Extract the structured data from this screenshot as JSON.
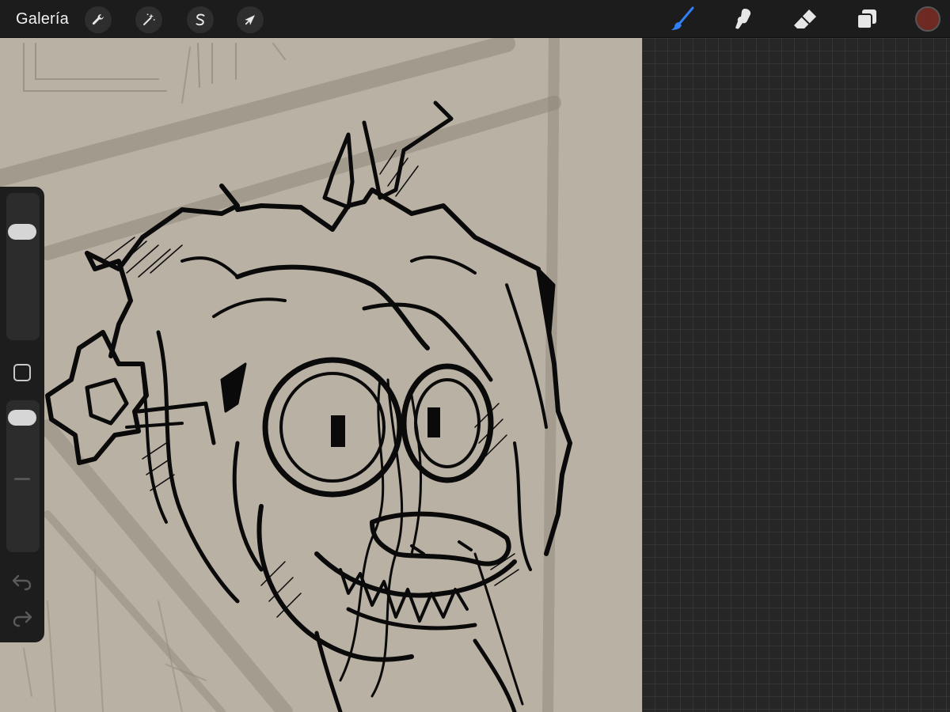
{
  "toolbar": {
    "gallery_label": "Galería",
    "left_tools": [
      {
        "icon": "wrench-icon",
        "name": "actions"
      },
      {
        "icon": "magic-wand-icon",
        "name": "adjustments"
      },
      {
        "icon": "selection-s-icon",
        "name": "selection"
      },
      {
        "icon": "arrow-cursor-icon",
        "name": "transform"
      }
    ],
    "right_tools": [
      {
        "icon": "brush-icon",
        "name": "paint",
        "active": true
      },
      {
        "icon": "smudge-icon",
        "name": "smudge"
      },
      {
        "icon": "eraser-icon",
        "name": "erase"
      },
      {
        "icon": "layers-icon",
        "name": "layers"
      }
    ],
    "current_color": "#6e2a22",
    "active_tool_color": "#2f7ff7"
  },
  "sidebar": {
    "brush_size_level": 0.78,
    "opacity_level": 0.95,
    "modify_button_icon": "square-icon",
    "undo_icon": "undo-icon",
    "redo_icon": "redo-icon"
  },
  "canvas": {
    "background_color": "#b9b1a3",
    "line_color": "#0a0a0a"
  }
}
